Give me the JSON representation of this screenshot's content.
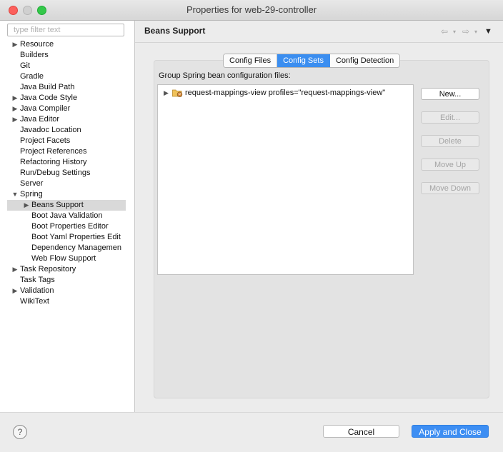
{
  "window": {
    "title": "Properties for web-29-controller"
  },
  "sidebar": {
    "filter_placeholder": "type filter text",
    "items": [
      {
        "label": "Resource",
        "arrow": "▶",
        "indent": 0
      },
      {
        "label": "Builders",
        "arrow": "",
        "indent": 0
      },
      {
        "label": "Git",
        "arrow": "",
        "indent": 0
      },
      {
        "label": "Gradle",
        "arrow": "",
        "indent": 0
      },
      {
        "label": "Java Build Path",
        "arrow": "",
        "indent": 0
      },
      {
        "label": "Java Code Style",
        "arrow": "▶",
        "indent": 0
      },
      {
        "label": "Java Compiler",
        "arrow": "▶",
        "indent": 0
      },
      {
        "label": "Java Editor",
        "arrow": "▶",
        "indent": 0
      },
      {
        "label": "Javadoc Location",
        "arrow": "",
        "indent": 0
      },
      {
        "label": "Project Facets",
        "arrow": "",
        "indent": 0
      },
      {
        "label": "Project References",
        "arrow": "",
        "indent": 0
      },
      {
        "label": "Refactoring History",
        "arrow": "",
        "indent": 0
      },
      {
        "label": "Run/Debug Settings",
        "arrow": "",
        "indent": 0
      },
      {
        "label": "Server",
        "arrow": "",
        "indent": 0
      },
      {
        "label": "Spring",
        "arrow": "▼",
        "indent": 0
      },
      {
        "label": "Beans Support",
        "arrow": "▶",
        "indent": 1,
        "selected": true
      },
      {
        "label": "Boot Java Validation",
        "arrow": "",
        "indent": 1
      },
      {
        "label": "Boot Properties Editor",
        "arrow": "",
        "indent": 1
      },
      {
        "label": "Boot Yaml Properties Edit",
        "arrow": "",
        "indent": 1
      },
      {
        "label": "Dependency Managemen",
        "arrow": "",
        "indent": 1
      },
      {
        "label": "Web Flow Support",
        "arrow": "",
        "indent": 1
      },
      {
        "label": "Task Repository",
        "arrow": "▶",
        "indent": 0
      },
      {
        "label": "Task Tags",
        "arrow": "",
        "indent": 0
      },
      {
        "label": "Validation",
        "arrow": "▶",
        "indent": 0
      },
      {
        "label": "WikiText",
        "arrow": "",
        "indent": 0
      }
    ]
  },
  "main": {
    "title": "Beans Support",
    "nav": {
      "back": "⇦",
      "forward": "⇨",
      "dropdown": "▾",
      "menu": "▼"
    },
    "tabs": [
      {
        "label": "Config Files",
        "active": false
      },
      {
        "label": "Config Sets",
        "active": true
      },
      {
        "label": "Config Detection",
        "active": false
      }
    ],
    "group_label": "Group Spring bean configuration files:",
    "list": [
      {
        "label": "request-mappings-view profiles=\"request-mappings-view\"",
        "arrow": "▶",
        "icon": "folder-bean-icon"
      }
    ],
    "buttons": {
      "new": "New...",
      "edit": "Edit...",
      "delete": "Delete",
      "move_up": "Move Up",
      "move_down": "Move Down"
    }
  },
  "footer": {
    "help": "?",
    "cancel": "Cancel",
    "apply_close": "Apply and Close"
  },
  "colors": {
    "accent": "#3b8ef0",
    "selection": "#d9d9d9"
  }
}
